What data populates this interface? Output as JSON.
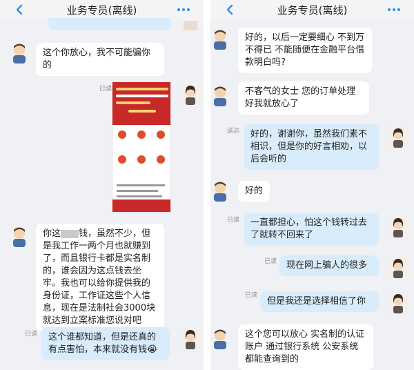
{
  "left": {
    "header": {
      "title": "业务专员(离线)"
    },
    "messages": [
      {
        "text": "这个你放心，我不可能骗你的"
      },
      {
        "read": "已读"
      },
      {
        "text_a": "你这",
        "text_b": "钱，虽然不少，但是我工作一两个月也就赚到了，而且银行卡都是实名制的，谁会因为这点钱去坐牢。我也可以给你提供我的身份证，工作证这些个人信息，现在是法制社会3000块就达到立案标准您说对吧"
      },
      {
        "read": "已读",
        "text": "这个谁都知道，但是还真的有点害怕，本来就没有钱😭"
      }
    ]
  },
  "right": {
    "header": {
      "title": "业务专员(离线)"
    },
    "messages": [
      {
        "text": "好的，以后一定要细心 不到万不得已 不能随便在金融平台借款明白吗?"
      },
      {
        "text": "不客气的女士 您的订单处理好我就放心了"
      },
      {
        "read": "送达",
        "text": "好的，谢谢你，虽然我们素不相识，但是你的好言相劝，以后会听的"
      },
      {
        "text": "好的"
      },
      {
        "read": "已读",
        "text": "一直都担心，怕这个钱转过去了就转不回来了"
      },
      {
        "read": "已读",
        "text": "现在网上骗人的很多"
      },
      {
        "read": "已读",
        "text": "但是我还是选择相信了你"
      },
      {
        "text": "这个您可以放心 实名制的认证账户 通过银行系统 公安系统都能查询到的"
      }
    ]
  },
  "colors": {
    "outgoing_bubble": "#d9ecfb",
    "incoming_bubble": "#ffffff",
    "accent": "#2f8fe8"
  },
  "icons": [
    "chevron-left-icon",
    "more-dots-icon",
    "agent-avatar",
    "user-avatar"
  ]
}
